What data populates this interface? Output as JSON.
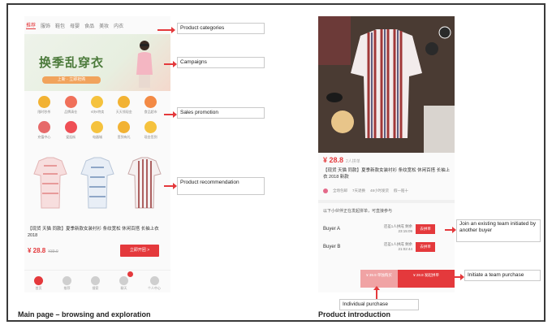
{
  "main_page": {
    "categories": [
      "推荐",
      "服饰",
      "鞋包",
      "母婴",
      "食品",
      "美妆",
      "内衣"
    ],
    "banner": {
      "title": "换季乱穿衣",
      "pill": "上新 · 立即抢购"
    },
    "promotions": [
      {
        "label": "限时秒杀",
        "color": "#f2b233"
      },
      {
        "label": "品牌清仓",
        "color": "#f0705a"
      },
      {
        "label": "9块9特卖",
        "color": "#f5c23d"
      },
      {
        "label": "天天领现金",
        "color": "#f2b233"
      },
      {
        "label": "食品超市",
        "color": "#f38a45"
      },
      {
        "label": "充值中心",
        "color": "#e66a6a"
      },
      {
        "label": "爱逛街",
        "color": "#ef4f55"
      },
      {
        "label": "电器城",
        "color": "#f5c23d"
      },
      {
        "label": "签到有礼",
        "color": "#f2b233"
      },
      {
        "label": "现金签到",
        "color": "#f5c23d"
      }
    ],
    "product": {
      "name": "【现货 天猫 同款】夏季新款女装衬衫 条纹宽松 休闲百搭 长袖上衣 2018",
      "price": "¥ 28.8",
      "old_price": "¥39.9",
      "button": "立即开团 >"
    },
    "tabs": [
      {
        "label": "首页",
        "active": true
      },
      {
        "label": "推荐",
        "active": false
      },
      {
        "label": "搜索",
        "active": false
      },
      {
        "label": "聊天",
        "active": false
      },
      {
        "label": "个人中心",
        "active": false
      }
    ]
  },
  "product_page": {
    "price": "¥ 28.8",
    "price_sub": "2人拼单",
    "name_tag": "【现货 天猫 同款】",
    "name": "夏季新款女装衬衫 条纹宽松 休闲百搭 长袖上衣 2018 新款",
    "guarantees": [
      "全场包邮",
      "7天退换",
      "48小时发货",
      "假一赔十"
    ],
    "team_header": "以下小伙伴正在发起拼单，可直接参与",
    "buyers": [
      {
        "name": "Buyer A",
        "info": "还差1人拼成 剩余 23:15:09",
        "button": "去拼单"
      },
      {
        "name": "Buyer B",
        "info": "还差1人拼成 剩余 21:02:44",
        "button": "去拼单"
      }
    ],
    "individual_button": "¥ 39.9 单独购买",
    "team_button": "¥ 28.8 发起拼单"
  },
  "annotations": {
    "product_categories": "Product categories",
    "campaigns": "Campaigns",
    "sales_promotion": "Sales promotion",
    "product_recommendation": "Product recommendation",
    "join_team": "Join an existing team initiated by another buyer",
    "initiate_team": "Initiate a team purchase",
    "individual_purchase": "Individual purchase"
  },
  "captions": {
    "left": "Main page – browsing and exploration",
    "right": "Product introduction"
  },
  "colors": {
    "accent": "#e4393c",
    "accent_light": "#f0a3a4"
  }
}
